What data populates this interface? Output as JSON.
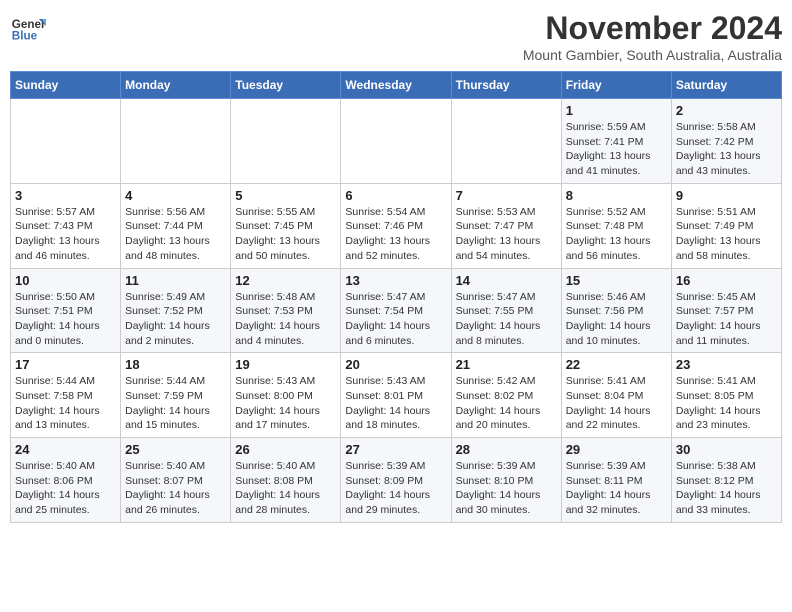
{
  "logo": {
    "line1": "General",
    "line2": "Blue"
  },
  "title": "November 2024",
  "subtitle": "Mount Gambier, South Australia, Australia",
  "days_of_week": [
    "Sunday",
    "Monday",
    "Tuesday",
    "Wednesday",
    "Thursday",
    "Friday",
    "Saturday"
  ],
  "weeks": [
    [
      {
        "day": "",
        "info": ""
      },
      {
        "day": "",
        "info": ""
      },
      {
        "day": "",
        "info": ""
      },
      {
        "day": "",
        "info": ""
      },
      {
        "day": "",
        "info": ""
      },
      {
        "day": "1",
        "info": "Sunrise: 5:59 AM\nSunset: 7:41 PM\nDaylight: 13 hours\nand 41 minutes."
      },
      {
        "day": "2",
        "info": "Sunrise: 5:58 AM\nSunset: 7:42 PM\nDaylight: 13 hours\nand 43 minutes."
      }
    ],
    [
      {
        "day": "3",
        "info": "Sunrise: 5:57 AM\nSunset: 7:43 PM\nDaylight: 13 hours\nand 46 minutes."
      },
      {
        "day": "4",
        "info": "Sunrise: 5:56 AM\nSunset: 7:44 PM\nDaylight: 13 hours\nand 48 minutes."
      },
      {
        "day": "5",
        "info": "Sunrise: 5:55 AM\nSunset: 7:45 PM\nDaylight: 13 hours\nand 50 minutes."
      },
      {
        "day": "6",
        "info": "Sunrise: 5:54 AM\nSunset: 7:46 PM\nDaylight: 13 hours\nand 52 minutes."
      },
      {
        "day": "7",
        "info": "Sunrise: 5:53 AM\nSunset: 7:47 PM\nDaylight: 13 hours\nand 54 minutes."
      },
      {
        "day": "8",
        "info": "Sunrise: 5:52 AM\nSunset: 7:48 PM\nDaylight: 13 hours\nand 56 minutes."
      },
      {
        "day": "9",
        "info": "Sunrise: 5:51 AM\nSunset: 7:49 PM\nDaylight: 13 hours\nand 58 minutes."
      }
    ],
    [
      {
        "day": "10",
        "info": "Sunrise: 5:50 AM\nSunset: 7:51 PM\nDaylight: 14 hours\nand 0 minutes."
      },
      {
        "day": "11",
        "info": "Sunrise: 5:49 AM\nSunset: 7:52 PM\nDaylight: 14 hours\nand 2 minutes."
      },
      {
        "day": "12",
        "info": "Sunrise: 5:48 AM\nSunset: 7:53 PM\nDaylight: 14 hours\nand 4 minutes."
      },
      {
        "day": "13",
        "info": "Sunrise: 5:47 AM\nSunset: 7:54 PM\nDaylight: 14 hours\nand 6 minutes."
      },
      {
        "day": "14",
        "info": "Sunrise: 5:47 AM\nSunset: 7:55 PM\nDaylight: 14 hours\nand 8 minutes."
      },
      {
        "day": "15",
        "info": "Sunrise: 5:46 AM\nSunset: 7:56 PM\nDaylight: 14 hours\nand 10 minutes."
      },
      {
        "day": "16",
        "info": "Sunrise: 5:45 AM\nSunset: 7:57 PM\nDaylight: 14 hours\nand 11 minutes."
      }
    ],
    [
      {
        "day": "17",
        "info": "Sunrise: 5:44 AM\nSunset: 7:58 PM\nDaylight: 14 hours\nand 13 minutes."
      },
      {
        "day": "18",
        "info": "Sunrise: 5:44 AM\nSunset: 7:59 PM\nDaylight: 14 hours\nand 15 minutes."
      },
      {
        "day": "19",
        "info": "Sunrise: 5:43 AM\nSunset: 8:00 PM\nDaylight: 14 hours\nand 17 minutes."
      },
      {
        "day": "20",
        "info": "Sunrise: 5:43 AM\nSunset: 8:01 PM\nDaylight: 14 hours\nand 18 minutes."
      },
      {
        "day": "21",
        "info": "Sunrise: 5:42 AM\nSunset: 8:02 PM\nDaylight: 14 hours\nand 20 minutes."
      },
      {
        "day": "22",
        "info": "Sunrise: 5:41 AM\nSunset: 8:04 PM\nDaylight: 14 hours\nand 22 minutes."
      },
      {
        "day": "23",
        "info": "Sunrise: 5:41 AM\nSunset: 8:05 PM\nDaylight: 14 hours\nand 23 minutes."
      }
    ],
    [
      {
        "day": "24",
        "info": "Sunrise: 5:40 AM\nSunset: 8:06 PM\nDaylight: 14 hours\nand 25 minutes."
      },
      {
        "day": "25",
        "info": "Sunrise: 5:40 AM\nSunset: 8:07 PM\nDaylight: 14 hours\nand 26 minutes."
      },
      {
        "day": "26",
        "info": "Sunrise: 5:40 AM\nSunset: 8:08 PM\nDaylight: 14 hours\nand 28 minutes."
      },
      {
        "day": "27",
        "info": "Sunrise: 5:39 AM\nSunset: 8:09 PM\nDaylight: 14 hours\nand 29 minutes."
      },
      {
        "day": "28",
        "info": "Sunrise: 5:39 AM\nSunset: 8:10 PM\nDaylight: 14 hours\nand 30 minutes."
      },
      {
        "day": "29",
        "info": "Sunrise: 5:39 AM\nSunset: 8:11 PM\nDaylight: 14 hours\nand 32 minutes."
      },
      {
        "day": "30",
        "info": "Sunrise: 5:38 AM\nSunset: 8:12 PM\nDaylight: 14 hours\nand 33 minutes."
      }
    ]
  ]
}
